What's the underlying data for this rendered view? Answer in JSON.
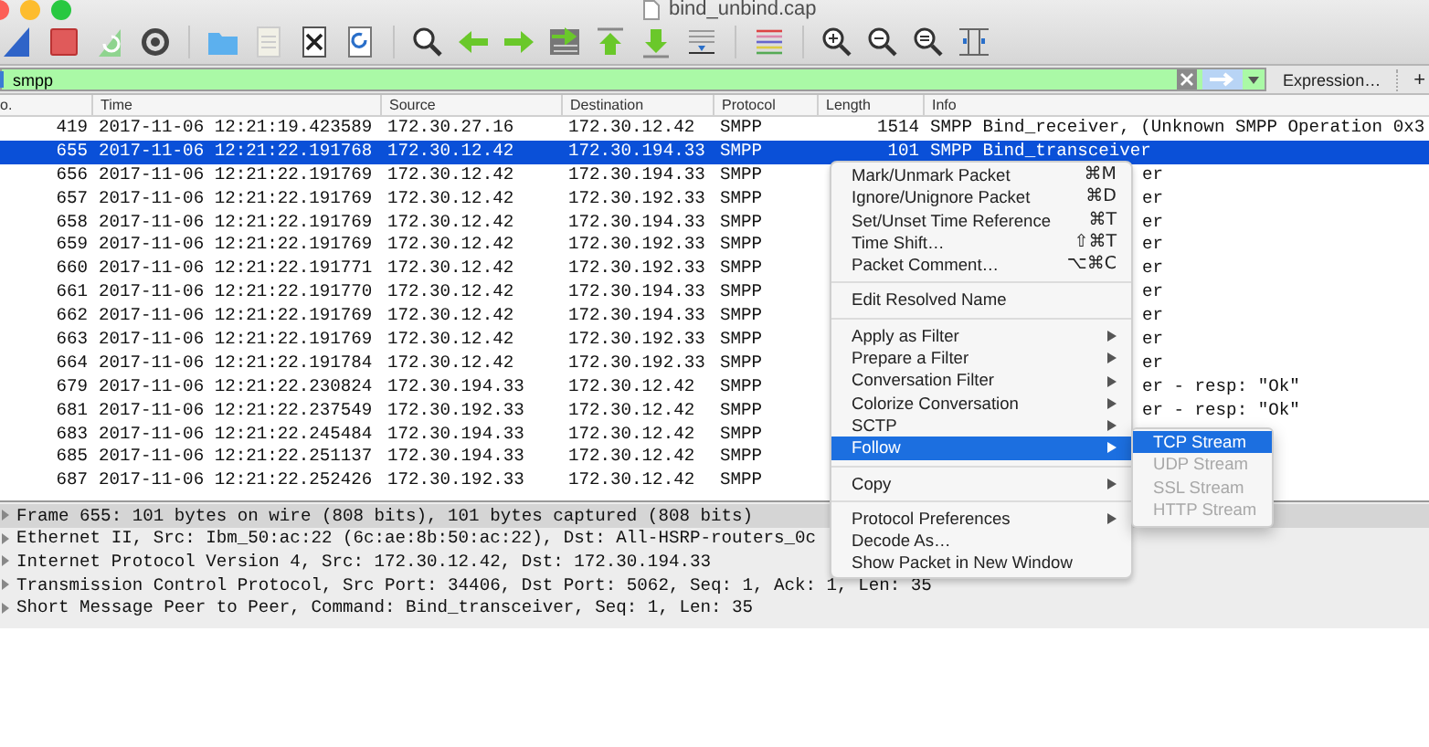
{
  "window": {
    "title": "bind_unbind.cap"
  },
  "filter": {
    "value": "smpp",
    "expression_button": "Expression…",
    "add_button": "+"
  },
  "packet_list": {
    "columns": [
      "o.",
      "Time",
      "Source",
      "Destination",
      "Protocol",
      "Length",
      "Info"
    ],
    "rows": [
      {
        "no": "419",
        "time": "2017-11-06 12:21:19.423589",
        "source": "172.30.27.16",
        "destination": "172.30.12.42",
        "protocol": "SMPP",
        "length": "1514",
        "info": "SMPP Bind_receiver, (Unknown SMPP Operation 0x3",
        "selected": false
      },
      {
        "no": "655",
        "time": "2017-11-06 12:21:22.191768",
        "source": "172.30.12.42",
        "destination": "172.30.194.33",
        "protocol": "SMPP",
        "length": "101",
        "info": "SMPP Bind_transceiver",
        "selected": true
      },
      {
        "no": "656",
        "time": "2017-11-06 12:21:22.191769",
        "source": "172.30.12.42",
        "destination": "172.30.194.33",
        "protocol": "SMPP",
        "info_tail": "er",
        "selected": false
      },
      {
        "no": "657",
        "time": "2017-11-06 12:21:22.191769",
        "source": "172.30.12.42",
        "destination": "172.30.192.33",
        "protocol": "SMPP",
        "info_tail": "er",
        "selected": false
      },
      {
        "no": "658",
        "time": "2017-11-06 12:21:22.191769",
        "source": "172.30.12.42",
        "destination": "172.30.194.33",
        "protocol": "SMPP",
        "info_tail": "er",
        "selected": false
      },
      {
        "no": "659",
        "time": "2017-11-06 12:21:22.191769",
        "source": "172.30.12.42",
        "destination": "172.30.192.33",
        "protocol": "SMPP",
        "info_tail": "er",
        "selected": false
      },
      {
        "no": "660",
        "time": "2017-11-06 12:21:22.191771",
        "source": "172.30.12.42",
        "destination": "172.30.192.33",
        "protocol": "SMPP",
        "info_tail": "er",
        "selected": false
      },
      {
        "no": "661",
        "time": "2017-11-06 12:21:22.191770",
        "source": "172.30.12.42",
        "destination": "172.30.194.33",
        "protocol": "SMPP",
        "info_tail": "er",
        "selected": false
      },
      {
        "no": "662",
        "time": "2017-11-06 12:21:22.191769",
        "source": "172.30.12.42",
        "destination": "172.30.194.33",
        "protocol": "SMPP",
        "info_tail": "er",
        "selected": false
      },
      {
        "no": "663",
        "time": "2017-11-06 12:21:22.191769",
        "source": "172.30.12.42",
        "destination": "172.30.192.33",
        "protocol": "SMPP",
        "info_tail": "er",
        "selected": false
      },
      {
        "no": "664",
        "time": "2017-11-06 12:21:22.191784",
        "source": "172.30.12.42",
        "destination": "172.30.192.33",
        "protocol": "SMPP",
        "info_tail": "er",
        "selected": false
      },
      {
        "no": "679",
        "time": "2017-11-06 12:21:22.230824",
        "source": "172.30.194.33",
        "destination": "172.30.12.42",
        "protocol": "SMPP",
        "info_tail": "er - resp: \"Ok\"",
        "selected": false
      },
      {
        "no": "681",
        "time": "2017-11-06 12:21:22.237549",
        "source": "172.30.192.33",
        "destination": "172.30.12.42",
        "protocol": "SMPP",
        "info_tail": "er - resp: \"Ok\"",
        "selected": false
      },
      {
        "no": "683",
        "time": "2017-11-06 12:21:22.245484",
        "source": "172.30.194.33",
        "destination": "172.30.12.42",
        "protocol": "SMPP",
        "selected": false
      },
      {
        "no": "685",
        "time": "2017-11-06 12:21:22.251137",
        "source": "172.30.194.33",
        "destination": "172.30.12.42",
        "protocol": "SMPP",
        "selected": false
      },
      {
        "no": "687",
        "time": "2017-11-06 12:21:22.252426",
        "source": "172.30.192.33",
        "destination": "172.30.12.42",
        "protocol": "SMPP",
        "selected": false
      }
    ]
  },
  "details": [
    {
      "text": "Frame 655: 101 bytes on wire (808 bits), 101 bytes captured (808 bits)",
      "selected": true,
      "expanded": false
    },
    {
      "text": "Ethernet II, Src: Ibm_50:ac:22 (6c:ae:8b:50:ac:22), Dst: All-HSRP-routers_0c",
      "selected": false,
      "expanded": false
    },
    {
      "text": "Internet Protocol Version 4, Src: 172.30.12.42, Dst: 172.30.194.33",
      "selected": false,
      "expanded": false
    },
    {
      "text": "Transmission Control Protocol, Src Port: 34406, Dst Port: 5062, Seq: 1, Ack: 1, Len: 35",
      "selected": false,
      "expanded": false
    },
    {
      "text": "Short Message Peer to Peer, Command: Bind_transceiver, Seq: 1, Len: 35",
      "selected": false,
      "expanded": false
    }
  ],
  "context_menu": {
    "items": [
      {
        "kind": "item",
        "label": "Mark/Unmark Packet",
        "shortcut": "⌘M",
        "submenu": false,
        "selected": false
      },
      {
        "kind": "item",
        "label": "Ignore/Unignore Packet",
        "shortcut": "⌘D",
        "submenu": false,
        "selected": false
      },
      {
        "kind": "item",
        "label": "Set/Unset Time Reference",
        "shortcut": "⌘T",
        "submenu": false,
        "selected": false
      },
      {
        "kind": "item",
        "label": "Time Shift…",
        "shortcut": "⇧⌘T",
        "submenu": false,
        "selected": false
      },
      {
        "kind": "item",
        "label": "Packet Comment…",
        "shortcut": "⌥⌘C",
        "submenu": false,
        "selected": false
      },
      {
        "kind": "separator"
      },
      {
        "kind": "item",
        "label": "Edit Resolved Name",
        "submenu": false,
        "selected": false
      },
      {
        "kind": "separator"
      },
      {
        "kind": "item",
        "label": "Apply as Filter",
        "submenu": true,
        "selected": false
      },
      {
        "kind": "item",
        "label": "Prepare a Filter",
        "submenu": true,
        "selected": false
      },
      {
        "kind": "item",
        "label": "Conversation Filter",
        "submenu": true,
        "selected": false
      },
      {
        "kind": "item",
        "label": "Colorize Conversation",
        "submenu": true,
        "selected": false
      },
      {
        "kind": "item",
        "label": "SCTP",
        "submenu": true,
        "selected": false
      },
      {
        "kind": "item",
        "label": "Follow",
        "submenu": true,
        "selected": true
      },
      {
        "kind": "separator"
      },
      {
        "kind": "item",
        "label": "Copy",
        "submenu": true,
        "selected": false
      },
      {
        "kind": "separator"
      },
      {
        "kind": "item",
        "label": "Protocol Preferences",
        "submenu": true,
        "selected": false
      },
      {
        "kind": "item",
        "label": "Decode As…",
        "submenu": false,
        "selected": false
      },
      {
        "kind": "item",
        "label": "Show Packet in New Window",
        "submenu": false,
        "selected": false
      }
    ]
  },
  "submenu": {
    "items": [
      {
        "label": "TCP Stream",
        "selected": true,
        "disabled": false
      },
      {
        "label": "UDP Stream",
        "selected": false,
        "disabled": true
      },
      {
        "label": "SSL Stream",
        "selected": false,
        "disabled": true
      },
      {
        "label": "HTTP Stream",
        "selected": false,
        "disabled": true
      }
    ]
  }
}
